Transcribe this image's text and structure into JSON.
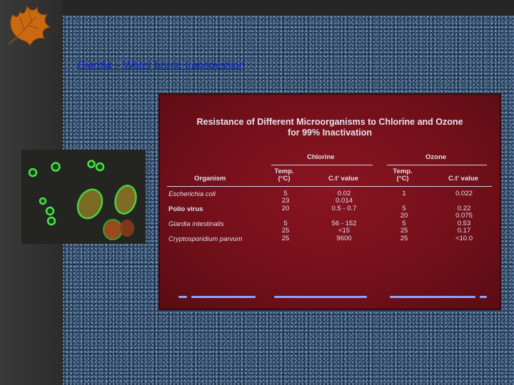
{
  "slide": {
    "title_italic": "Giardia",
    "title_rest": " – Water borne transmission"
  },
  "table": {
    "heading_line1": "Resistance of Different Microorganisms to Chlorine and Ozone",
    "heading_line2": "for 99% Inactivation",
    "group_chlorine": "Chlorine",
    "group_ozone": "Ozone",
    "col_organism": "Organism",
    "col_temp": "Temp.\n(°C)",
    "col_ct": "C.t' value",
    "rows": [
      {
        "organism": "Escherichia coli",
        "italic": true,
        "cl_temp": "5\n23\n20",
        "cl_ct": "0.02\n0.014\n0.5 - 0.7",
        "oz_temp": "1",
        "oz_ct": "0.022"
      },
      {
        "organism": "Polio virus",
        "italic": false,
        "cl_temp": "",
        "cl_ct": "",
        "oz_temp": "5\n20",
        "oz_ct": "0.22\n0.075"
      },
      {
        "organism": "Giardia intestinalis",
        "italic": true,
        "cl_temp": "5\n25",
        "cl_ct": "56 - 152\n<15",
        "oz_temp": "5\n25",
        "oz_ct": "0.53\n0.17"
      },
      {
        "organism": "Cryptosporidium parvum",
        "italic": true,
        "cl_temp": "25",
        "cl_ct": "9600",
        "oz_temp": "25",
        "oz_ct": "<10.0"
      }
    ]
  },
  "icons": {
    "leaf": "autumn-leaf-icon"
  },
  "colors": {
    "title_link": "#0a1fd6",
    "background": "#2c4b6f",
    "table_red": "#7a121c",
    "cyst_green": "#3cd23c"
  }
}
